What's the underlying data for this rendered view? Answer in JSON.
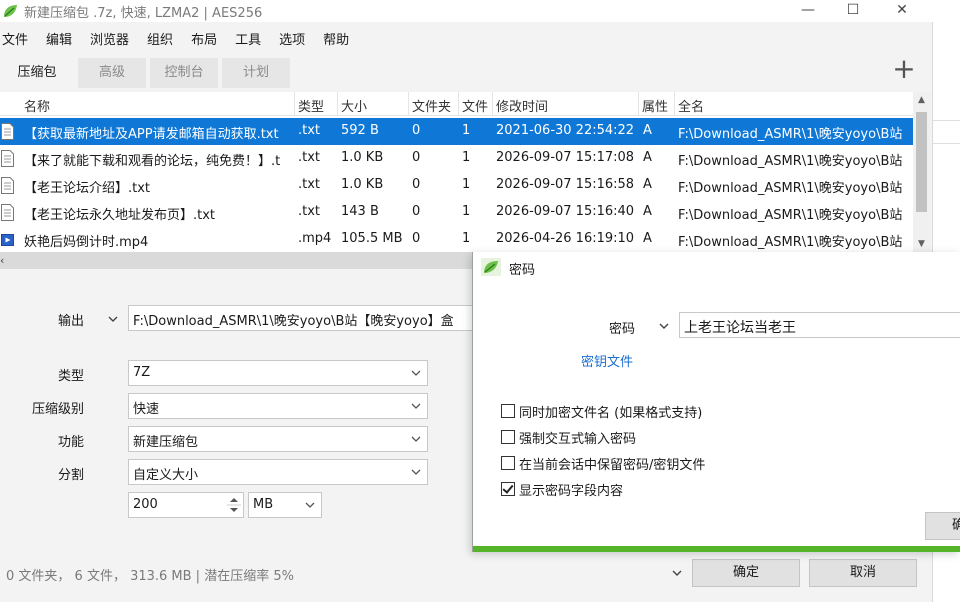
{
  "window": {
    "title": "新建压缩包 .7z, 快速, LZMA2 | AES256",
    "win_minimize": "—",
    "win_maximize": "☐",
    "win_close": "✕"
  },
  "menu": [
    "文件",
    "编辑",
    "浏览器",
    "组织",
    "布局",
    "工具",
    "选项",
    "帮助"
  ],
  "tabs": [
    "压缩包",
    "高级",
    "控制台",
    "计划"
  ],
  "add_button": "+",
  "columns": [
    "名称",
    "类型",
    "大小",
    "文件夹",
    "文件",
    "修改时间",
    "属性",
    "全名"
  ],
  "files": [
    {
      "name": "【获取最新地址及APP请发邮箱自动获取.txt",
      "type": ".txt",
      "size": "592 B",
      "folders": "0",
      "files": "1",
      "modified": "2021-06-30 22:54:22",
      "attr": "A",
      "fullname": "F:\\Download_ASMR\\1\\晚安yoyo\\B站",
      "selected": true,
      "icon": "text-file-icon"
    },
    {
      "name": "【来了就能下载和观看的论坛，纯免费！】.t",
      "type": ".txt",
      "size": "1.0 KB",
      "folders": "0",
      "files": "1",
      "modified": "2026-09-07 15:17:08",
      "attr": "A",
      "fullname": "F:\\Download_ASMR\\1\\晚安yoyo\\B站",
      "selected": false,
      "icon": "text-file-icon"
    },
    {
      "name": "【老王论坛介绍】.txt",
      "type": ".txt",
      "size": "1.0 KB",
      "folders": "0",
      "files": "1",
      "modified": "2026-09-07 15:16:58",
      "attr": "A",
      "fullname": "F:\\Download_ASMR\\1\\晚安yoyo\\B站",
      "selected": false,
      "icon": "text-file-icon"
    },
    {
      "name": "【老王论坛永久地址发布页】.txt",
      "type": ".txt",
      "size": "143 B",
      "folders": "0",
      "files": "1",
      "modified": "2026-09-07 15:16:40",
      "attr": "A",
      "fullname": "F:\\Download_ASMR\\1\\晚安yoyo\\B站",
      "selected": false,
      "icon": "text-file-icon"
    },
    {
      "name": "妖艳后妈倒计时.mp4",
      "type": ".mp4",
      "size": "105.5 MB",
      "folders": "0",
      "files": "1",
      "modified": "2026-04-26 16:19:10",
      "attr": "A",
      "fullname": "F:\\Download_ASMR\\1\\晚安yoyo\\B站",
      "selected": false,
      "icon": "video-file-icon"
    }
  ],
  "form": {
    "output_label": "输出",
    "output_value": "F:\\Download_ASMR\\1\\晚安yoyo\\B站【晚安yoyo】盒",
    "type_label": "类型",
    "type_value": "7Z",
    "level_label": "压缩级别",
    "level_value": "快速",
    "function_label": "功能",
    "function_value": "新建压缩包",
    "split_label": "分割",
    "split_value": "自定义大小",
    "split_size": "200",
    "split_unit": "MB"
  },
  "status_text": "0 文件夹， 6 文件， 313.6 MB | 潜在压缩率 5%",
  "buttons": {
    "ok": "确定",
    "cancel": "取消"
  },
  "dialog": {
    "title": "密码",
    "password_label": "密码",
    "password_value": "上老王论坛当老王",
    "keyfile_link": "密钥文件",
    "options": [
      {
        "label": "同时加密文件名 (如果格式支持)",
        "checked": false
      },
      {
        "label": "强制交互式输入密码",
        "checked": false
      },
      {
        "label": "在当前会话中保留密码/密钥文件",
        "checked": false
      },
      {
        "label": "显示密码字段内容",
        "checked": true
      }
    ],
    "partial_button": "确"
  },
  "colors": {
    "selection": "#0f78d7",
    "accent_green": "#55b427",
    "link": "#1a6fd0"
  }
}
